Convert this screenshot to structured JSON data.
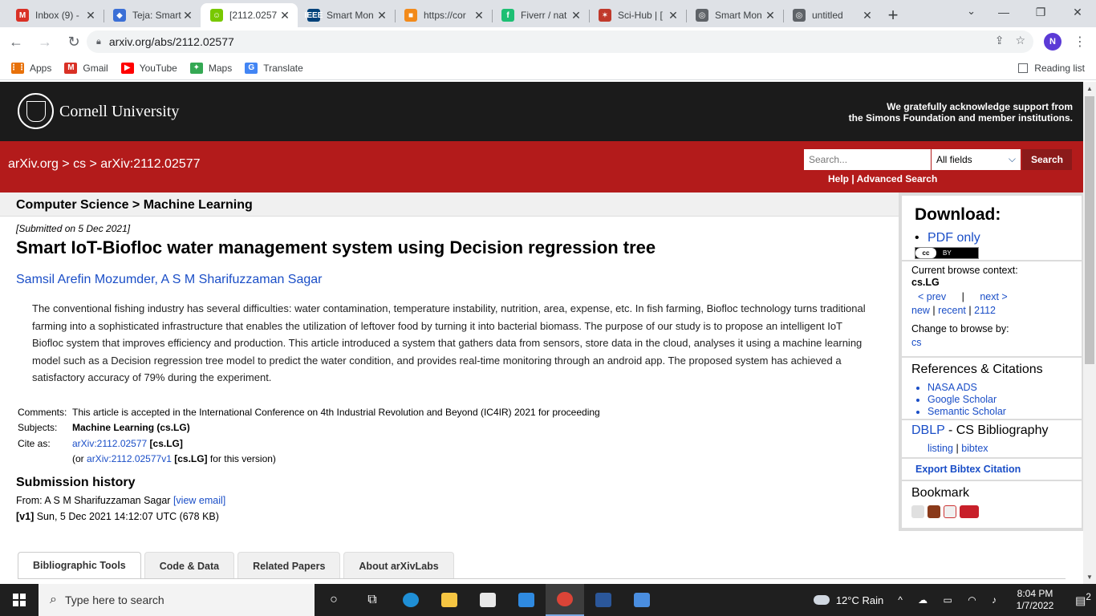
{
  "browser": {
    "tabs": [
      {
        "title": "Inbox (9) -",
        "favicon": "M",
        "color": "#d93025",
        "active": false
      },
      {
        "title": "Teja: Smart",
        "favicon": "◆",
        "color": "#3b6fd6",
        "active": false
      },
      {
        "title": "[2112.0257",
        "favicon": "☺",
        "color": "#78c800",
        "active": true
      },
      {
        "title": "Smart Mon",
        "favicon": "IEEE",
        "color": "#00427a",
        "active": false
      },
      {
        "title": "https://cor",
        "favicon": "■",
        "color": "#f28a1a",
        "active": false
      },
      {
        "title": "Fiverr / nat",
        "favicon": "f",
        "color": "#1dbf73",
        "active": false
      },
      {
        "title": "Sci-Hub | [",
        "favicon": "✶",
        "color": "#c0392b",
        "active": false
      },
      {
        "title": "Smart Mon",
        "favicon": "◎",
        "color": "#5f6368",
        "active": false
      },
      {
        "title": "untitled",
        "favicon": "◎",
        "color": "#5f6368",
        "active": false
      }
    ],
    "url": "arxiv.org/abs/2112.02577",
    "profile_initial": "N",
    "bookmarks": [
      {
        "label": "Apps",
        "color": "#e8710a",
        "icon": "⋮⋮"
      },
      {
        "label": "Gmail",
        "color": "#d93025",
        "icon": "M"
      },
      {
        "label": "YouTube",
        "color": "#ff0000",
        "icon": "▶"
      },
      {
        "label": "Maps",
        "color": "#34a853",
        "icon": "✦"
      },
      {
        "label": "Translate",
        "color": "#4285f4",
        "icon": "G"
      }
    ],
    "reading_list": "Reading list"
  },
  "header": {
    "university": "Cornell University",
    "support_line1": "We gratefully acknowledge support from",
    "support_line2": "the Simons Foundation and member institutions."
  },
  "searchbar": {
    "breadcrumb": "arXiv.org > cs > arXiv:2112.02577",
    "placeholder": "Search...",
    "field": "All fields",
    "button": "Search",
    "help": "Help | Advanced Search"
  },
  "subject_bar": "Computer Science > Machine Learning",
  "paper": {
    "submitted": "[Submitted on 5 Dec 2021]",
    "title": "Smart IoT-Biofloc water management system using Decision regression tree",
    "authors": "Samsil Arefin Mozumder, A S M Sharifuzzaman Sagar",
    "abstract": "The conventional fishing industry has several difficulties: water contamination, temperature instability, nutrition, area, expense, etc. In fish farming, Biofloc technology turns traditional farming into a sophisticated infrastructure that enables the utilization of leftover food by turning it into bacterial biomass. The purpose of our study is to propose an intelligent IoT Biofloc system that improves efficiency and production. This article introduced a system that gathers data from sensors, store data in the cloud, analyses it using a machine learning model such as a Decision regression tree model to predict the water condition, and provides real-time monitoring through an android app. The proposed system has achieved a satisfactory accuracy of 79% during the experiment.",
    "comments_label": "Comments:",
    "comments": "This article is accepted in the International Conference on 4th Industrial Revolution and Beyond (IC4IR) 2021 for proceeding",
    "subjects_label": "Subjects:",
    "subjects": "Machine Learning (cs.LG)",
    "cite_label": "Cite as:",
    "cite_id": "arXiv:2112.02577",
    "cite_cat": "[cs.LG]",
    "cite_alt_prefix": "(or",
    "cite_alt_id": "arXiv:2112.02577v1",
    "cite_alt_cat": "[cs.LG]",
    "cite_alt_suffix": "for this version)",
    "history_title": "Submission history",
    "history_from": "From: A S M Sharifuzzaman Sagar",
    "history_view_email": "[view email]",
    "history_v1_label": "[v1]",
    "history_v1": "Sun, 5 Dec 2021 14:12:07 UTC (678 KB)"
  },
  "bottom_tabs": [
    "Bibliographic Tools",
    "Code & Data",
    "Related Papers",
    "About arXivLabs"
  ],
  "sidebar": {
    "download_title": "Download:",
    "pdf_only": "PDF only",
    "cc_label": "cc",
    "by_label": "BY",
    "browse_context_label": "Current browse context:",
    "browse_context": "cs.LG",
    "prev": "< prev",
    "sep": "|",
    "next": "next >",
    "new": "new",
    "recent": "recent",
    "month": "2112",
    "change_browse": "Change to browse by:",
    "browse_cs": "cs",
    "refs_title": "References & Citations",
    "refs": [
      "NASA ADS",
      "Google Scholar",
      "Semantic Scholar"
    ],
    "dblp": "DBLP",
    "dblp_rest": "- CS Bibliography",
    "listing": "listing",
    "bibtex": "bibtex",
    "export": "Export Bibtex Citation",
    "bookmark": "Bookmark"
  },
  "taskbar": {
    "search_placeholder": "Type here to search",
    "weather": "12°C  Rain",
    "time": "8:04 PM",
    "date": "1/7/2022",
    "notifications": "2"
  }
}
